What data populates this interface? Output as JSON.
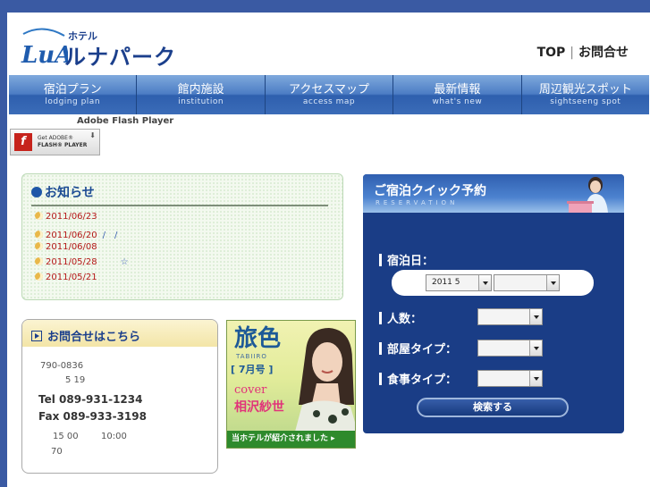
{
  "header": {
    "logo_small": "ホテル",
    "logo_big": "ルナパーク",
    "top_link": "TOP",
    "contact_link": "お問合せ"
  },
  "nav": [
    {
      "ja": "宿泊プラン",
      "en": "lodging plan"
    },
    {
      "ja": "館内施設",
      "en": "institution"
    },
    {
      "ja": "アクセスマップ",
      "en": "access map"
    },
    {
      "ja": "最新情報",
      "en": "what's new"
    },
    {
      "ja": "周辺観光スポット",
      "en": "sightseeng spot"
    }
  ],
  "flash": {
    "label": "Adobe Flash Player",
    "badge_line1": "Get ADOBE®",
    "badge_line2": "FLASH® PLAYER"
  },
  "news": {
    "title": "お知らせ",
    "items": [
      {
        "date": "2011/06/23",
        "extra": ""
      },
      {
        "date": "2011/06/20",
        "extra": "/　/"
      },
      {
        "date": "2011/06/08",
        "extra": ""
      },
      {
        "date": "2011/05/28",
        "extra": "☆"
      },
      {
        "date": "2011/05/21",
        "extra": ""
      }
    ]
  },
  "contact": {
    "title": "お問合せはこちら",
    "zip": "790-0836",
    "number": "5 19",
    "tel": "Tel  089-931-1234",
    "fax": "Fax  089-933-3198",
    "time1": "15 00",
    "time2": "10:00",
    "rooms": "70"
  },
  "banner": {
    "title": "旅色",
    "subtitle": "TABIIRO",
    "month": "[ 7月号 ]",
    "cover": "cover",
    "name": "相沢紗世",
    "bar_text": "当ホテルが紹介されました ▸"
  },
  "reservation": {
    "title": "ご宿泊クイック予約",
    "subtitle": "RESERVATION",
    "date_label": "宿泊日：",
    "year_month": "2011 5",
    "day": "",
    "people_label": "人数：",
    "people": "",
    "room_label": "部屋タイプ：",
    "room": "",
    "meal_label": "食事タイプ：",
    "meal": "",
    "search_label": "検索する"
  },
  "colors": {
    "nav_blue": "#2f5da8",
    "resv_navy": "#1a3d86",
    "news_date_red": "#b51818"
  }
}
